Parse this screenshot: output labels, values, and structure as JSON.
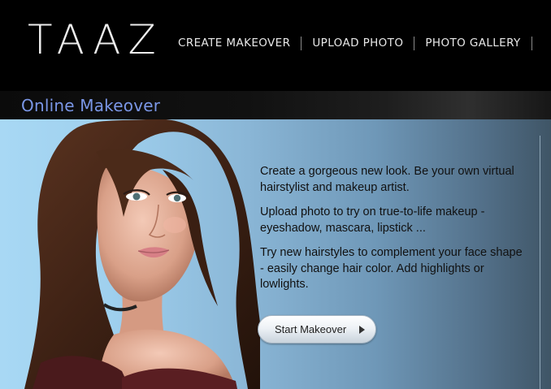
{
  "brand": {
    "logo_text": "TAAZ"
  },
  "nav": {
    "items": [
      {
        "label": "CREATE MAKEOVER"
      },
      {
        "label": "UPLOAD PHOTO"
      },
      {
        "label": "PHOTO GALLERY"
      }
    ]
  },
  "page": {
    "title": "Online Makeover"
  },
  "hero": {
    "paragraphs": [
      "Create a gorgeous new look. Be your own virtual hairstylist and makeup artist.",
      "Upload photo to try on true-to-life makeup - eyeshadow, mascara, lipstick ...",
      "Try new hairstyles to complement your face shape - easily change hair color. Add highlights or lowlights."
    ],
    "button_label": "Start Makeover",
    "button_icon": "play-triangle-icon"
  },
  "colors": {
    "title": "#7a96e6",
    "header_bg": "#000000",
    "hero_light": "#a8d8f4",
    "hero_dark": "#3f5566"
  }
}
